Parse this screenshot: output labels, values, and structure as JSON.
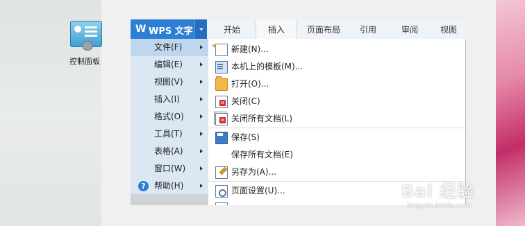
{
  "desktop": {
    "icon_label": "控制面板"
  },
  "wps": {
    "title": "WPS 文字",
    "logo_letter": "W",
    "tabs": [
      {
        "label": "开始"
      },
      {
        "label": "插入"
      },
      {
        "label": "页面布局"
      },
      {
        "label": "引用"
      },
      {
        "label": "审阅"
      },
      {
        "label": "视图"
      }
    ],
    "active_tab": "插入",
    "menu": [
      {
        "label": "文件(F)"
      },
      {
        "label": "编辑(E)"
      },
      {
        "label": "视图(V)"
      },
      {
        "label": "插入(I)"
      },
      {
        "label": "格式(O)"
      },
      {
        "label": "工具(T)"
      },
      {
        "label": "表格(A)"
      },
      {
        "label": "窗口(W)"
      },
      {
        "label": "帮助(H)"
      }
    ],
    "selected_menu": "文件(F)",
    "submenu": [
      {
        "label": "新建(N)...",
        "icon": "new-document-icon"
      },
      {
        "label": "本机上的模板(M)...",
        "icon": "template-icon"
      },
      {
        "label": "打开(O)...",
        "icon": "open-folder-icon"
      },
      {
        "label": "关闭(C)",
        "icon": "close-document-icon"
      },
      {
        "label": "关闭所有文档(L)",
        "icon": "close-all-icon"
      },
      {
        "label": "保存(S)",
        "icon": "save-icon"
      },
      {
        "label": "保存所有文档(E)",
        "icon": ""
      },
      {
        "label": "另存为(A)...",
        "icon": "save-as-icon"
      },
      {
        "label": "页面设置(U)...",
        "icon": "page-setup-icon"
      }
    ]
  },
  "watermark": {
    "brand": "Bai 经验",
    "url": "jingyan.baidu.com"
  },
  "colors": {
    "accent": "#2d7fd4",
    "menu_bg": "#dbe7f3",
    "menu_selected": "#bfd7ee"
  }
}
